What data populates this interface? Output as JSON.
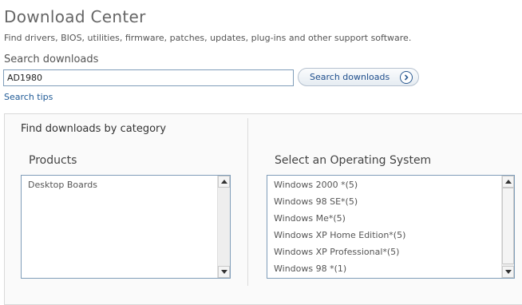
{
  "header": {
    "title": "Download Center",
    "subtitle": "Find drivers, BIOS, utilities, firmware, patches, updates, plug-ins and other support software."
  },
  "search": {
    "label": "Search downloads",
    "value": "AD1980",
    "button_label": "Search downloads",
    "tips_label": "Search tips"
  },
  "category": {
    "heading": "Find downloads by category",
    "products": {
      "heading": "Products",
      "items": [
        "Desktop Boards"
      ]
    },
    "os": {
      "heading": "Select an Operating System",
      "items": [
        "Windows 2000 *(5)",
        "Windows 98 SE*(5)",
        "Windows Me*(5)",
        "Windows XP Home Edition*(5)",
        "Windows XP Professional*(5)",
        "Windows 98 *(1)"
      ]
    }
  },
  "colors": {
    "link": "#1f5a96",
    "input_border": "#7f9db9",
    "button_text": "#1f4e8c"
  },
  "icons": {
    "search_button": "circle-chevron-right-icon",
    "scroll_up": "arrow-up-icon",
    "scroll_down": "arrow-down-icon"
  }
}
